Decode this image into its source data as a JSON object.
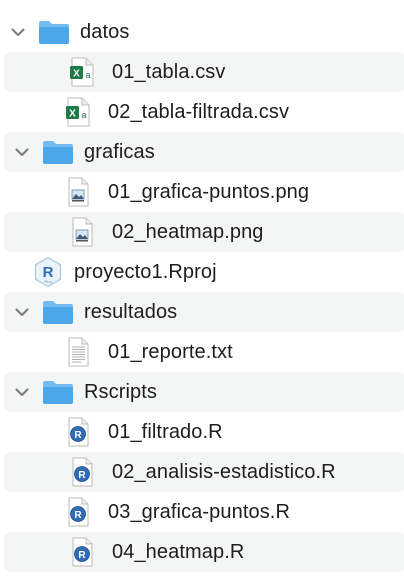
{
  "tree": {
    "datos": {
      "label": "datos",
      "files": [
        "01_tabla.csv",
        "02_tabla-filtrada.csv"
      ]
    },
    "graficas": {
      "label": "graficas",
      "files": [
        "01_grafica-puntos.png",
        "02_heatmap.png"
      ]
    },
    "project": {
      "label": "proyecto1.Rproj"
    },
    "resultados": {
      "label": "resultados",
      "files": [
        "01_reporte.txt"
      ]
    },
    "rscripts": {
      "label": "Rscripts",
      "files": [
        "01_filtrado.R",
        "02_analisis-estadistico.R",
        "03_grafica-puntos.R",
        "04_heatmap.R"
      ]
    }
  },
  "icons": {
    "folder": "folder-icon",
    "csv": "excel-csv-icon",
    "png": "image-file-icon",
    "rproj": "rproject-icon",
    "txt": "text-file-icon",
    "r": "r-script-icon",
    "disclosure": "chevron-down-icon"
  },
  "colors": {
    "folder": "#4aa8e8",
    "folder_back": "#74bcef",
    "excel_green": "#1f7a45",
    "r_blue": "#2f6db5",
    "stripe": "#f4f5f5"
  }
}
